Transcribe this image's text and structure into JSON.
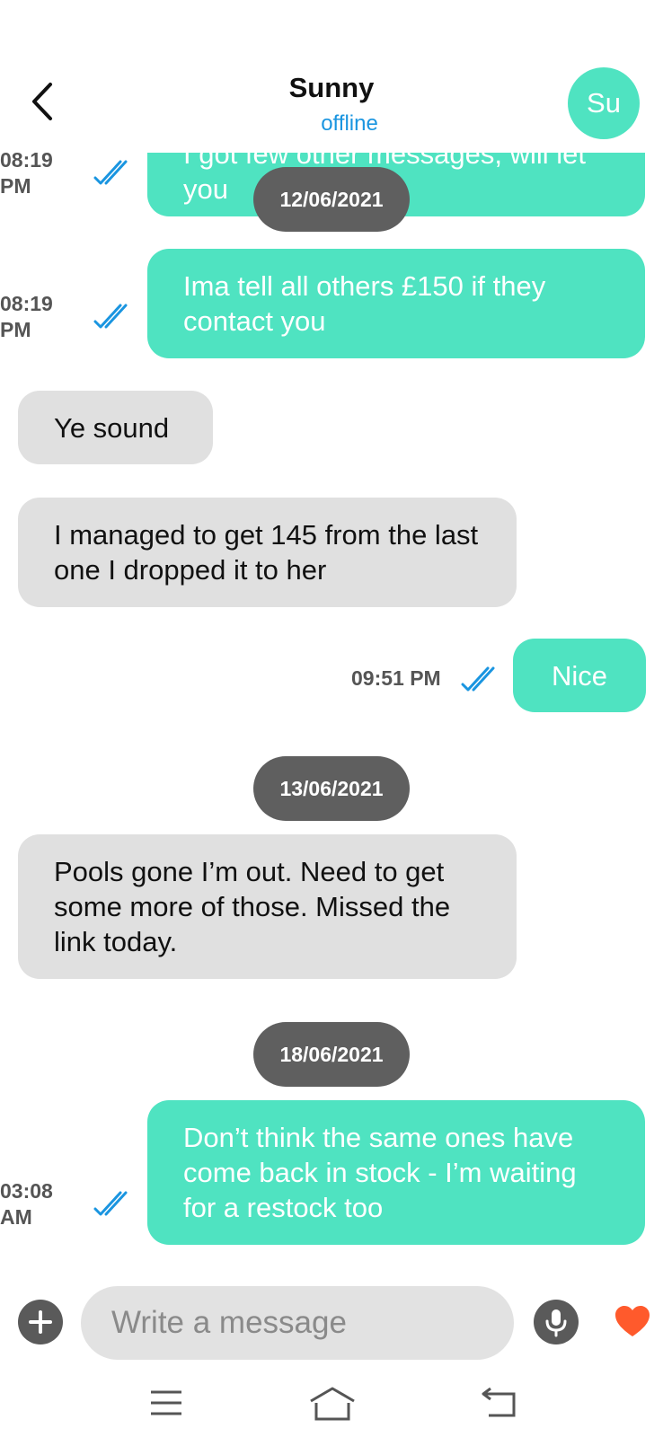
{
  "header": {
    "contact_name": "Sunny",
    "status": "offline",
    "avatar_initials": "Su"
  },
  "messages": [
    {
      "direction": "out",
      "text": "I got few other messages, will let you",
      "time": "08:19\nPM",
      "read": true,
      "partial": true
    },
    {
      "type": "date",
      "text": "12/06/2021"
    },
    {
      "direction": "out",
      "text": "Ima tell all others £150 if they contact you",
      "time": "08:19\nPM",
      "read": true
    },
    {
      "direction": "in",
      "text": "Ye sound"
    },
    {
      "direction": "in",
      "text": "I managed to get 145 from the last one I dropped it to her"
    },
    {
      "direction": "out",
      "text": "Nice",
      "time": "09:51 PM",
      "read": true
    },
    {
      "type": "date",
      "text": "13/06/2021"
    },
    {
      "direction": "in",
      "text": "Pools gone I’m out. Need to get some more of those. Missed the link today."
    },
    {
      "type": "date",
      "text": "18/06/2021"
    },
    {
      "direction": "out",
      "text": "Don’t think the same ones have come back in stock - I’m waiting for a restock too",
      "time": "03:08\nAM",
      "read": true
    }
  ],
  "composer": {
    "placeholder": "Write a message",
    "value": ""
  },
  "icons": {
    "back": "chevron-left-icon",
    "read_receipt": "double-check-icon",
    "attach": "plus-circle-icon",
    "mic": "microphone-icon",
    "reaction": "heart-icon",
    "nav": [
      "menu-icon",
      "home-icon",
      "back-icon"
    ]
  },
  "colors": {
    "outgoing_bubble": "#4fe3c1",
    "incoming_bubble": "#e0e0e0",
    "date_pill": "#5f5f5f",
    "status_text": "#1a95e0",
    "read_check": "#1a95e0",
    "heart": "#ff5a2c"
  }
}
